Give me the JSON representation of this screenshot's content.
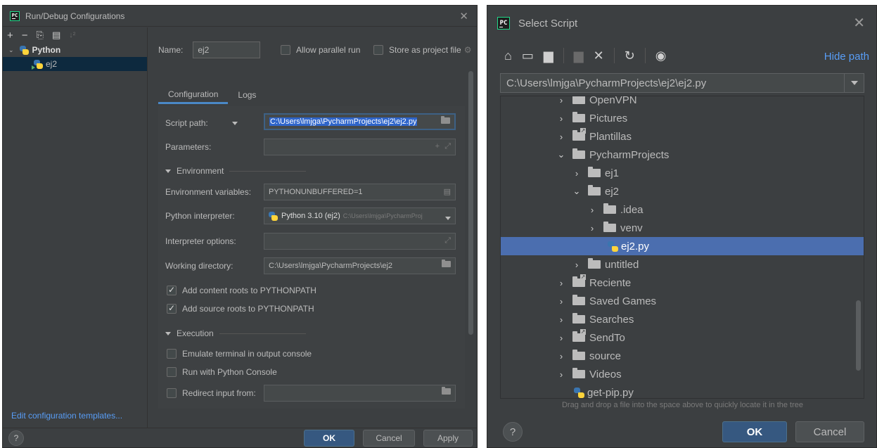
{
  "left": {
    "title": "Run/Debug Configurations",
    "toolbar": {
      "add": "+",
      "remove": "−",
      "copy": "⎘",
      "folder": "▤",
      "sort": "↓²"
    },
    "tree": {
      "group": "Python",
      "item": "ej2"
    },
    "edit_templates": "Edit configuration templates...",
    "name_label": "Name:",
    "name_value": "ej2",
    "allow_parallel": "Allow parallel run",
    "store_project": "Store as project file",
    "tabs": [
      "Configuration",
      "Logs"
    ],
    "script_path_label": "Script path:",
    "script_path_value": "C:\\Users\\lmjga\\PycharmProjects\\ej2\\ej2.py",
    "parameters_label": "Parameters:",
    "environment_section": "Environment",
    "env_vars_label": "Environment variables:",
    "env_vars_value": "PYTHONUNBUFFERED=1",
    "interpreter_label": "Python interpreter:",
    "interpreter_value": "Python 3.10 (ej2)",
    "interpreter_path": "C:\\Users\\lmjga\\PycharmProj",
    "interp_options_label": "Interpreter options:",
    "working_dir_label": "Working directory:",
    "working_dir_value": "C:\\Users\\lmjga\\PycharmProjects\\ej2",
    "add_content_roots": "Add content roots to PYTHONPATH",
    "add_source_roots": "Add source roots to PYTHONPATH",
    "execution_section": "Execution",
    "emulate_terminal": "Emulate terminal in output console",
    "run_console": "Run with Python Console",
    "redirect_input": "Redirect input from:",
    "help": "?",
    "ok": "OK",
    "cancel": "Cancel",
    "apply": "Apply"
  },
  "right": {
    "title": "Select Script",
    "hide_path": "Hide path",
    "path_value": "C:\\Users\\lmjga\\PycharmProjects\\ej2\\ej2.py",
    "tree": [
      {
        "label": "OpenVPN",
        "expanded": false,
        "type": "folder"
      },
      {
        "label": "Pictures",
        "expanded": false,
        "type": "folder"
      },
      {
        "label": "Plantillas",
        "expanded": false,
        "type": "link"
      },
      {
        "label": "PycharmProjects",
        "expanded": true,
        "type": "folder"
      },
      {
        "label": "ej1",
        "expanded": false,
        "type": "folder"
      },
      {
        "label": "ej2",
        "expanded": true,
        "type": "folder"
      },
      {
        "label": ".idea",
        "expanded": false,
        "type": "folder"
      },
      {
        "label": "venv",
        "expanded": false,
        "type": "folder"
      },
      {
        "label": "ej2.py",
        "type": "pyfile"
      },
      {
        "label": "untitled",
        "expanded": false,
        "type": "folder"
      },
      {
        "label": "Reciente",
        "expanded": false,
        "type": "link"
      },
      {
        "label": "Saved Games",
        "expanded": false,
        "type": "folder"
      },
      {
        "label": "Searches",
        "expanded": false,
        "type": "folder"
      },
      {
        "label": "SendTo",
        "expanded": false,
        "type": "link"
      },
      {
        "label": "source",
        "expanded": false,
        "type": "folder"
      },
      {
        "label": "Videos",
        "expanded": false,
        "type": "folder"
      },
      {
        "label": "get-pip.py",
        "type": "pyfile"
      }
    ],
    "hint": "Drag and drop a file into the space above to quickly locate it in the tree",
    "help": "?",
    "ok": "OK",
    "cancel": "Cancel"
  }
}
